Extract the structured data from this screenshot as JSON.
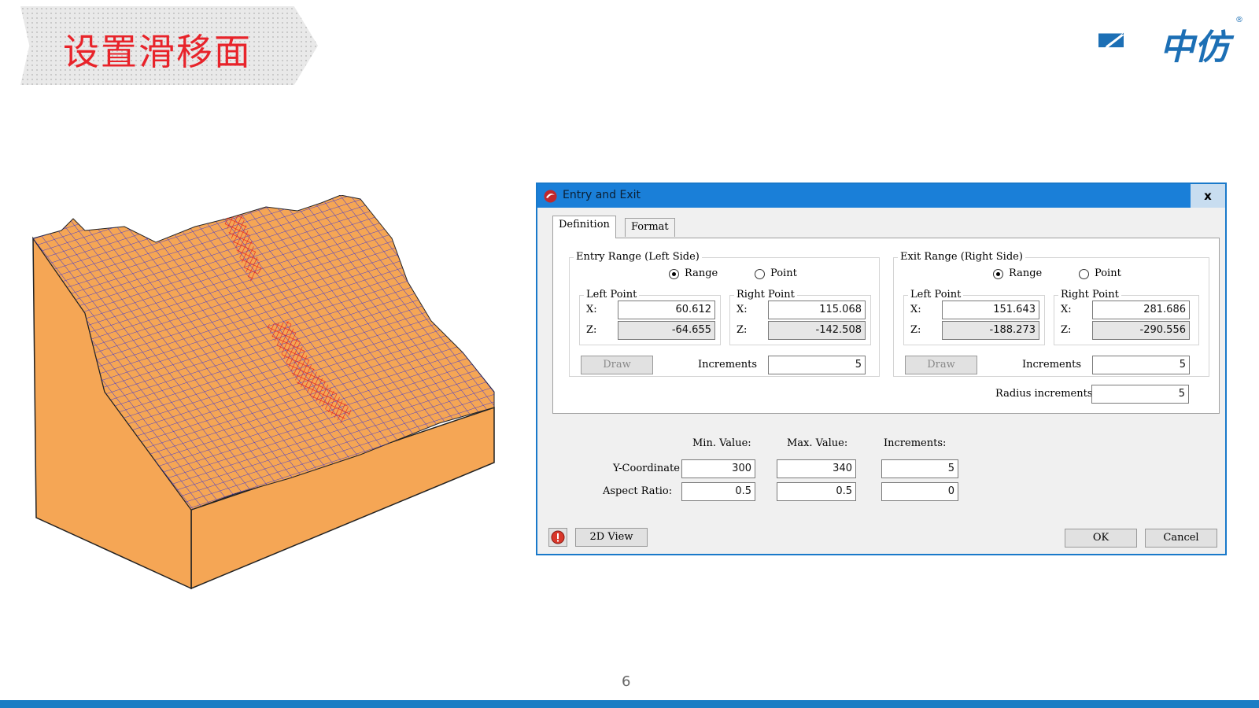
{
  "slide": {
    "title": "设置滑移面",
    "page_number": "6",
    "logo_text": "中仿",
    "logo_reg": "®",
    "accent_color": "#e8232a",
    "logo_color": "#1c6fb5"
  },
  "dialog": {
    "title": "Entry and Exit",
    "close_label": "x",
    "tabs": [
      {
        "label": "Definition",
        "active": true
      },
      {
        "label": "Format",
        "active": false
      }
    ],
    "entry": {
      "legend": "Entry Range (Left Side)",
      "range_label": "Range",
      "point_label": "Point",
      "selected": "range",
      "left_point": {
        "legend": "Left Point",
        "x_label": "X:",
        "z_label": "Z:",
        "x": "60.612",
        "z": "-64.655"
      },
      "right_point": {
        "legend": "Right Point",
        "x_label": "X:",
        "z_label": "Z:",
        "x": "115.068",
        "z": "-142.508"
      },
      "draw_label": "Draw",
      "increments_label": "Increments",
      "increments": "5"
    },
    "exit": {
      "legend": "Exit Range (Right Side)",
      "range_label": "Range",
      "point_label": "Point",
      "selected": "range",
      "left_point": {
        "legend": "Left Point",
        "x_label": "X:",
        "z_label": "Z:",
        "x": "151.643",
        "z": "-188.273"
      },
      "right_point": {
        "legend": "Right Point",
        "x_label": "X:",
        "z_label": "Z:",
        "x": "281.686",
        "z": "-290.556"
      },
      "draw_label": "Draw",
      "increments_label": "Increments",
      "increments": "5",
      "radius_label": "Radius increments",
      "radius_increments": "5"
    },
    "params": {
      "min_header": "Min. Value:",
      "max_header": "Max. Value:",
      "inc_header": "Increments:",
      "y_label": "Y-Coordinate",
      "aspect_label": "Aspect Ratio:",
      "y_min": "300",
      "y_max": "340",
      "y_inc": "5",
      "a_min": "0.5",
      "a_max": "0.5",
      "a_inc": "0"
    },
    "view2d_label": "2D View",
    "ok_label": "OK",
    "cancel_label": "Cancel"
  },
  "terrain_colors": {
    "fill": "#f5a655",
    "mesh": "#2020d8",
    "slip": "#e02020",
    "edge": "#222222"
  }
}
